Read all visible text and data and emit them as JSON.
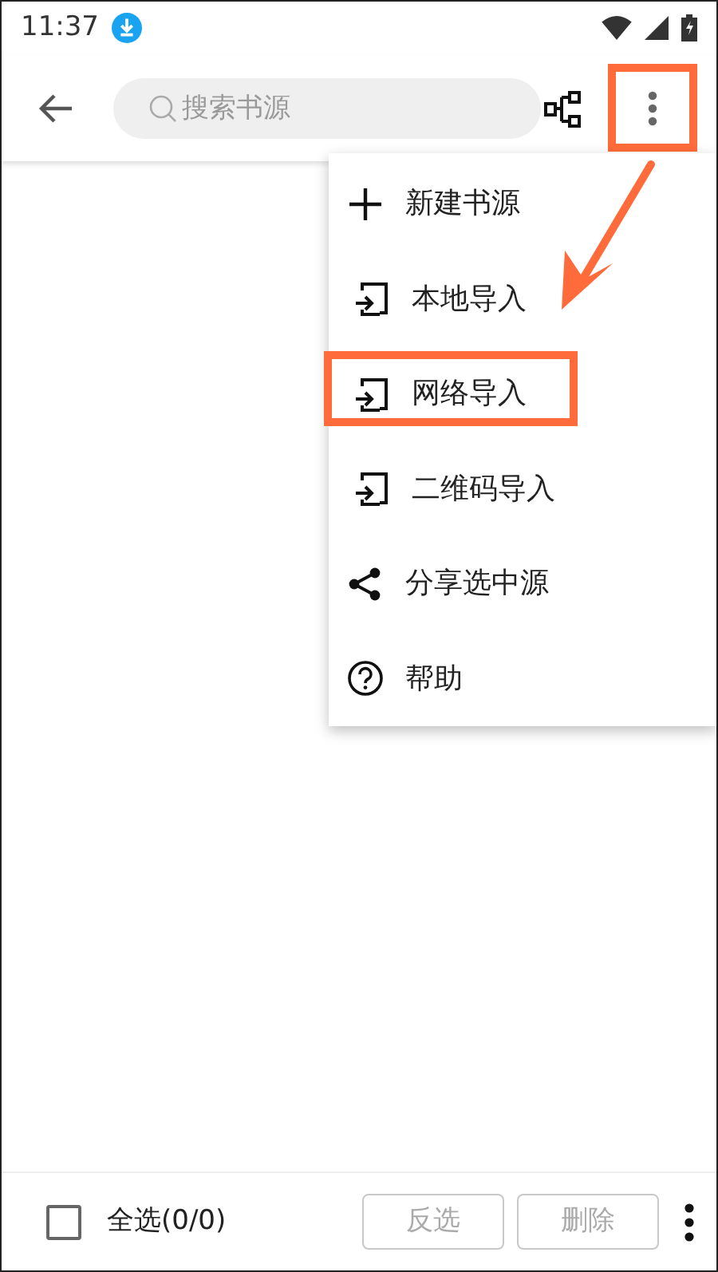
{
  "status_bar": {
    "time": "11:37"
  },
  "toolbar": {
    "search": {
      "placeholder": "搜索书源"
    },
    "more_highlighted": true
  },
  "menu": {
    "items": [
      {
        "kind": "add",
        "label": "新建书源",
        "highlighted": false
      },
      {
        "kind": "import",
        "label": "本地导入",
        "highlighted": false
      },
      {
        "kind": "import",
        "label": "网络导入",
        "highlighted": true
      },
      {
        "kind": "import",
        "label": "二维码导入",
        "highlighted": false
      },
      {
        "kind": "share",
        "label": "分享选中源",
        "highlighted": false
      },
      {
        "kind": "help",
        "label": "帮助",
        "highlighted": false
      }
    ]
  },
  "annotation_arrow": true,
  "bottom_bar": {
    "select_all": {
      "label": "全选(0/0)",
      "checked": false
    },
    "buttons": [
      {
        "label": "反选",
        "disabled": true
      },
      {
        "label": "删除",
        "disabled": true
      }
    ]
  }
}
